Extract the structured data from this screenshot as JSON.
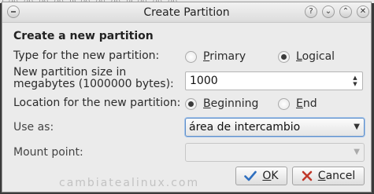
{
  "background_strip": "2 (0) (0) (0) (0) 10 (0) (0) (0) 10 (0) (0) (0)",
  "window": {
    "title": "Create Partition",
    "help_glyph": "?",
    "minimize_glyph": "⌄",
    "maximize_glyph": "⌃",
    "close_glyph": "✕"
  },
  "form": {
    "heading": "Create a new partition",
    "type": {
      "label": "Type for the new partition:",
      "options": [
        "Primary",
        "Logical"
      ],
      "option_mnemonics": [
        "P",
        "L"
      ],
      "option_rests": [
        "rimary",
        "ogical"
      ],
      "selected": "Logical"
    },
    "size": {
      "label_line1": "New partition size in",
      "label_line2": "megabytes (1000000 bytes):",
      "value": "1000"
    },
    "location": {
      "label": "Location for the new partition:",
      "options": [
        "Beginning",
        "End"
      ],
      "option_mnemonics": [
        "B",
        "E"
      ],
      "option_rests": [
        "eginning",
        "nd"
      ],
      "selected": "Beginning"
    },
    "use_as": {
      "label": "Use as:",
      "value": "área de intercambio"
    },
    "mount_point": {
      "label": "Mount point:",
      "value": ""
    }
  },
  "buttons": {
    "ok": {
      "mnemonic": "O",
      "rest": "K"
    },
    "cancel": {
      "mnemonic": "C",
      "rest": "ancel"
    }
  },
  "watermark": "cambiatealinux.com",
  "colors": {
    "focus_border": "#5f8fc9",
    "ok_check": "#2f6fbf",
    "cancel_x": "#c0392b"
  }
}
